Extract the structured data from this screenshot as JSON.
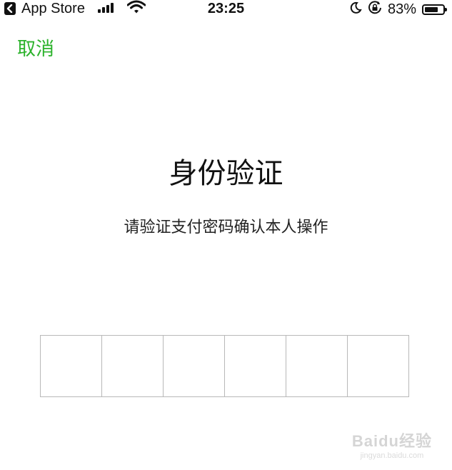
{
  "status_bar": {
    "back_app": "App Store",
    "time": "23:25",
    "battery_percent": "83%",
    "battery_level": 0.83
  },
  "header": {
    "cancel_label": "取消"
  },
  "main": {
    "title": "身份验证",
    "subtitle": "请验证支付密码确认本人操作",
    "pin_cells": [
      "",
      "",
      "",
      "",
      "",
      ""
    ]
  },
  "watermark": {
    "logo": "Baidu经验",
    "site": "jingyan.baidu.com"
  },
  "colors": {
    "accent": "#2bb22b",
    "cell_border": "#b8b8b8"
  }
}
